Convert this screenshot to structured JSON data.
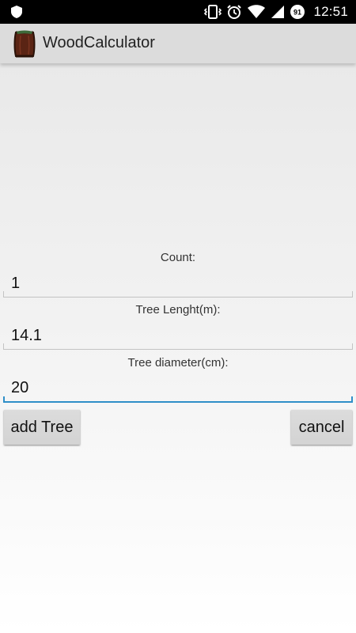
{
  "status_bar": {
    "time": "12:51",
    "battery_level": "91",
    "icons": [
      "shield-icon",
      "vibrate-icon",
      "alarm-icon",
      "wifi-icon",
      "signal-icon",
      "battery-icon"
    ]
  },
  "app": {
    "title": "WoodCalculator",
    "icon": "wood-barrel-icon"
  },
  "form": {
    "count": {
      "label": "Count:",
      "value": "1"
    },
    "length": {
      "label": "Tree Lenght(m):",
      "value": "14.1"
    },
    "diameter": {
      "label": "Tree diameter(cm):",
      "value": "20"
    }
  },
  "buttons": {
    "add_tree": "add Tree",
    "cancel": "cancel"
  },
  "colors": {
    "focus_accent": "#2f8fc8",
    "action_bar": "#dcdcdc",
    "status_bar": "#000000"
  }
}
